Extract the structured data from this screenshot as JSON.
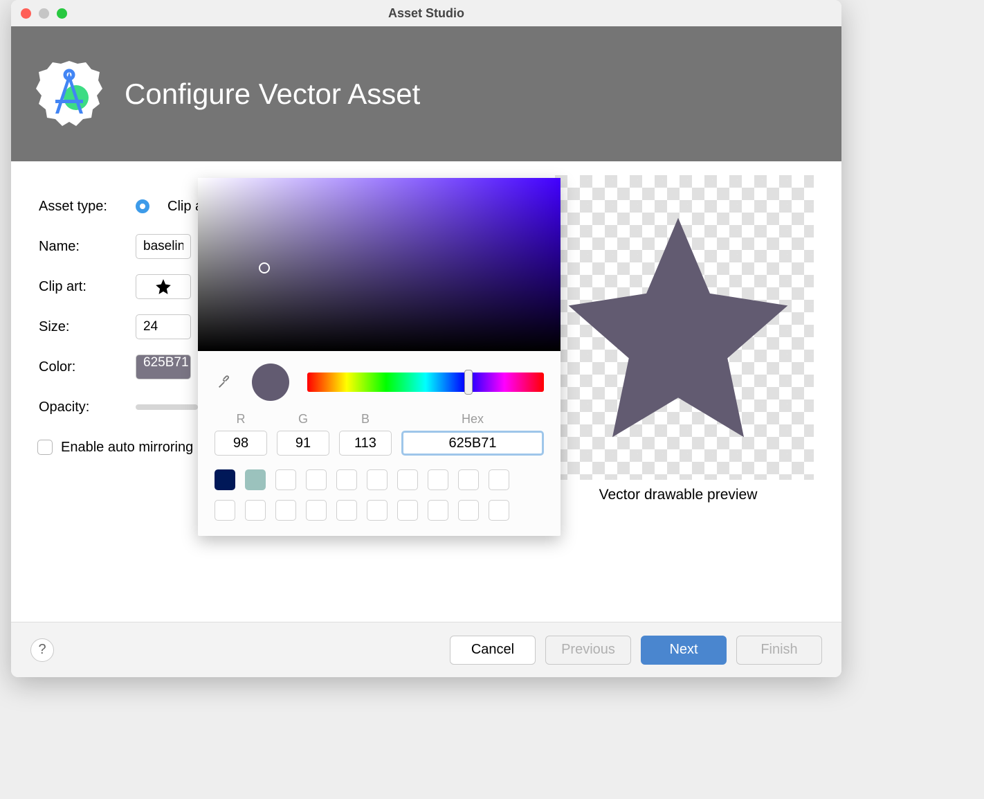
{
  "window_title": "Asset Studio",
  "banner_title": "Configure Vector Asset",
  "labels": {
    "asset_type": "Asset type:",
    "name": "Name:",
    "clip_art": "Clip art:",
    "size": "Size:",
    "color": "Color:",
    "opacity": "Opacity:",
    "enable_mirror": "Enable auto mirroring for RTL layout"
  },
  "values": {
    "asset_type_option": "Clip art",
    "name": "baseline",
    "size": "24",
    "color_hex_short": "625B71"
  },
  "preview_caption": "Vector drawable preview",
  "picker": {
    "r_label": "R",
    "g_label": "G",
    "b_label": "B",
    "hex_label": "Hex",
    "r": "98",
    "g": "91",
    "b": "113",
    "hex": "625B71",
    "hue_position_pct": 68,
    "swatches": [
      "#001858",
      "#9bc2bd"
    ]
  },
  "buttons": {
    "cancel": "Cancel",
    "previous": "Previous",
    "next": "Next",
    "finish": "Finish"
  },
  "colors": {
    "accent": "#4a86cf",
    "star": "#625B71"
  }
}
